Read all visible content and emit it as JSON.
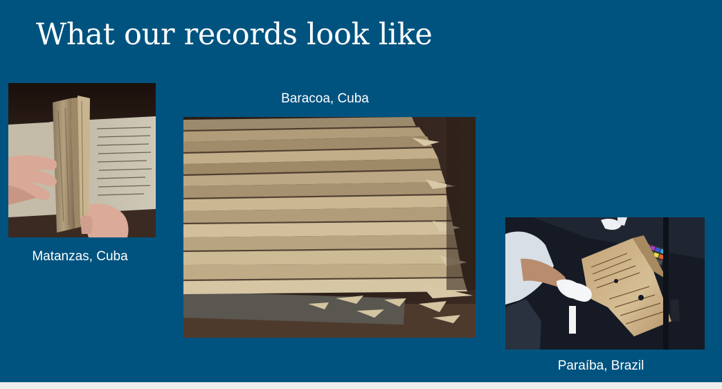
{
  "slide": {
    "title": "What our records look like",
    "background_color": "#00537f"
  },
  "photos": [
    {
      "caption": "Matanzas, Cuba",
      "image": "hands-holding-bound-manuscript-photo"
    },
    {
      "caption": "Baracoa, Cuba",
      "image": "stack-of-deteriorated-papers-photo"
    },
    {
      "caption": "Paraíba, Brazil",
      "image": "gloved-hands-photographing-document-photo"
    }
  ]
}
